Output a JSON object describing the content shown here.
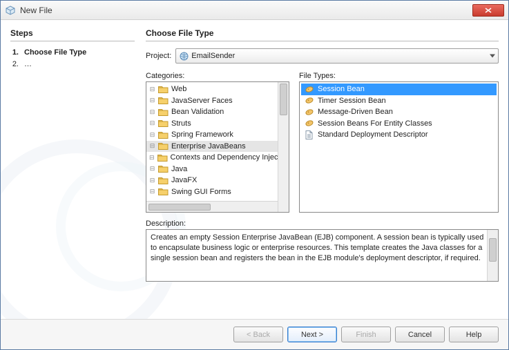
{
  "window": {
    "title": "New File"
  },
  "steps": {
    "heading": "Steps",
    "items": [
      {
        "num": "1.",
        "label": "Choose File Type",
        "active": true
      },
      {
        "num": "2.",
        "label": "…",
        "active": false
      }
    ]
  },
  "wizard": {
    "heading": "Choose File Type",
    "project_label": "Project:",
    "project_value": "EmailSender",
    "categories_label": "Categories:",
    "filetypes_label": "File Types:",
    "categories": [
      "Web",
      "JavaServer Faces",
      "Bean Validation",
      "Struts",
      "Spring Framework",
      "Enterprise JavaBeans",
      "Contexts and Dependency Injection",
      "Java",
      "JavaFX",
      "Swing GUI Forms"
    ],
    "categories_selected_index": 5,
    "filetypes": [
      "Session Bean",
      "Timer Session Bean",
      "Message-Driven Bean",
      "Session Beans For Entity Classes",
      "Standard Deployment Descriptor"
    ],
    "filetypes_selected_index": 0,
    "description_label": "Description:",
    "description_text": "Creates an empty Session Enterprise JavaBean (EJB) component. A session bean is typically used to encapsulate business logic or enterprise resources. This template creates the Java classes for a single session bean and registers the bean in the EJB module's deployment descriptor, if required."
  },
  "buttons": {
    "back": "< Back",
    "next": "Next >",
    "finish": "Finish",
    "cancel": "Cancel",
    "help": "Help"
  }
}
